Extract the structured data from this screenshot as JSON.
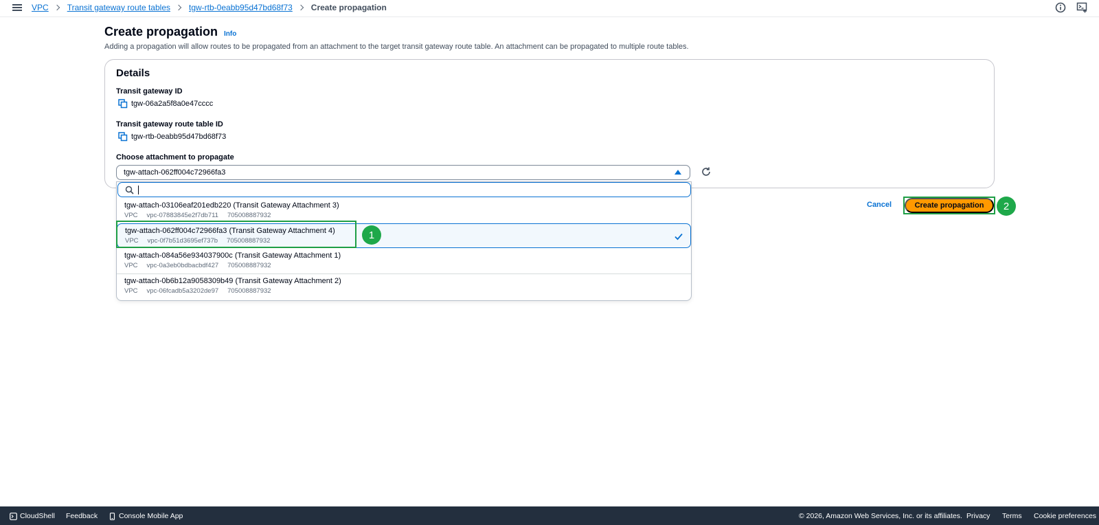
{
  "breadcrumb": {
    "items": [
      "VPC",
      "Transit gateway route tables",
      "tgw-rtb-0eabb95d47bd68f73"
    ],
    "current": "Create propagation"
  },
  "header": {
    "title": "Create propagation",
    "info_label": "Info",
    "description": "Adding a propagation will allow routes to be propagated from an attachment to the target transit gateway route table. An attachment can be propagated to multiple route tables."
  },
  "details": {
    "title": "Details",
    "transit_gateway_id_label": "Transit gateway ID",
    "transit_gateway_id": "tgw-06a2a5f8a0e47cccc",
    "route_table_id_label": "Transit gateway route table ID",
    "route_table_id": "tgw-rtb-0eabb95d47bd68f73",
    "attachment_label": "Choose attachment to propagate",
    "attachment_selected": "tgw-attach-062ff004c72966fa3"
  },
  "dropdown": {
    "search_value": "",
    "options": [
      {
        "name": "tgw-attach-03106eaf201edb220 (Transit Gateway Attachment 3)",
        "type": "VPC",
        "vpc": "vpc-07883845e2f7db711",
        "account": "705008887932"
      },
      {
        "name": "tgw-attach-062ff004c72966fa3 (Transit Gateway Attachment 4)",
        "type": "VPC",
        "vpc": "vpc-0f7b51d3695ef737b",
        "account": "705008887932"
      },
      {
        "name": "tgw-attach-084a56e934037900c (Transit Gateway Attachment 1)",
        "type": "VPC",
        "vpc": "vpc-0a3eb0bdbacbdf427",
        "account": "705008887932"
      },
      {
        "name": "tgw-attach-0b6b12a9058309b49 (Transit Gateway Attachment 2)",
        "type": "VPC",
        "vpc": "vpc-06fcadb5a3202de97",
        "account": "705008887932"
      }
    ]
  },
  "actions": {
    "cancel": "Cancel",
    "create": "Create propagation"
  },
  "annotations": {
    "badge1": "1",
    "badge2": "2"
  },
  "footer": {
    "cloudshell": "CloudShell",
    "feedback": "Feedback",
    "mobile_app": "Console Mobile App",
    "copyright": "© 2026, Amazon Web Services, Inc. or its affiliates.",
    "privacy": "Privacy",
    "terms": "Terms",
    "cookie": "Cookie preferences"
  },
  "colors": {
    "link": "#0972d3",
    "primary_button": "#ff9900",
    "annotation": "#1ea84a",
    "footer_bg": "#232f3e"
  },
  "icons": [
    "menu-icon",
    "info-circle-icon",
    "cloudshell-icon",
    "copy-icon",
    "refresh-icon",
    "search-icon",
    "check-icon",
    "caret-up-icon",
    "mobile-icon"
  ]
}
